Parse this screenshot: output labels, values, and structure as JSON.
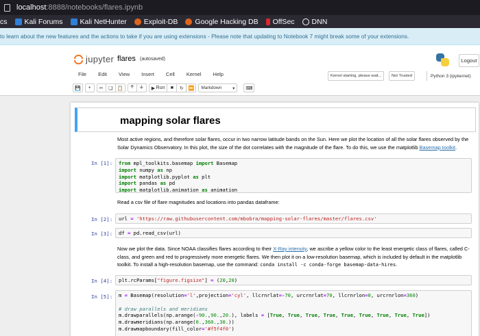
{
  "browser": {
    "url_host": "localhost",
    "url_rest": ":8888/notebooks/flares.ipynb",
    "bookmarks": [
      {
        "label": "cs",
        "icon": "none-icon"
      },
      {
        "label": "Kali Forums",
        "icon": "kali-icon"
      },
      {
        "label": "Kali NetHunter",
        "icon": "kali-icon"
      },
      {
        "label": "Exploit-DB",
        "icon": "exploit-db-icon"
      },
      {
        "label": "Google Hacking DB",
        "icon": "ghdb-icon"
      },
      {
        "label": "OffSec",
        "icon": "offsec-icon"
      },
      {
        "label": "DNN",
        "icon": "globe-icon"
      }
    ]
  },
  "banner": {
    "text": "to learn about the new features and the actions to take if you are using extensions - Please note that updating to Notebook 7 might break some of your extensions."
  },
  "header": {
    "logo_text": "jupyter",
    "notebook_name": "flares",
    "autosave": "(autosaved)",
    "logout_label": "Logout",
    "menu": [
      "File",
      "Edit",
      "View",
      "Insert",
      "Cell",
      "Kernel",
      "Help"
    ],
    "kernel_status": "Kernel starting, please wait...",
    "trust_status": "Not Trusted",
    "kernel_name": "Python 3 (ipykernel)",
    "toolbar": {
      "run_label": "Run",
      "cell_type": "Markdown"
    }
  },
  "notebook": {
    "title": "mapping solar flares",
    "intro_text": "Most active regions, and therefore solar flares, occur in two narrow latitude bands on the Sun. Here we plot the location of all the solar flares observed by the Solar Dynamics Observatory. In this plot, the size of the dot correlates with the magnitude of the flare. To do this, we use the matplotlib",
    "intro_link": "Basemap toolkit",
    "prompt1": "In [1]:",
    "read_csv_text": "Read a csv file of flare magnitudes and locations into pandas dataframe:",
    "prompt2": "In [2]:",
    "prompt3": "In [3]:",
    "noaa_text_a": "Now we plot the data. Since NOAA classifies flares according to their",
    "noaa_link": "X-Ray intensity",
    "noaa_text_b": ", we ascribe a yellow color to the least energetic class of flares, called C-class, and green and red to progressively more energetic flares. We then plot it on a low-resolution basemap, which is included by default in the matplotlib toolkit. To install a high-resolution basemap, use the command:",
    "noaa_code": "conda install -c conda-forge basemap-data-hires",
    "noaa_end": ".",
    "prompt4": "In [4]:",
    "prompt5": "In [5]:"
  }
}
